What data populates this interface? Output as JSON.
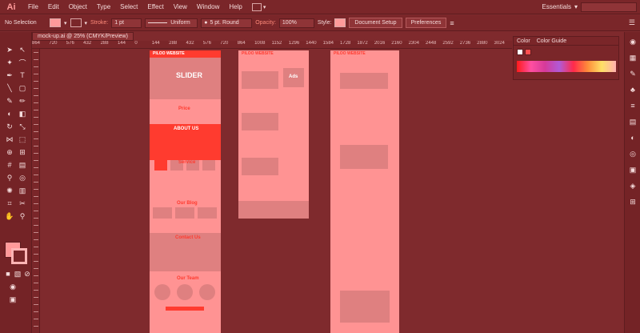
{
  "app": {
    "logo": "Ai"
  },
  "menu": [
    "File",
    "Edit",
    "Object",
    "Type",
    "Select",
    "Effect",
    "View",
    "Window",
    "Help"
  ],
  "workspace": "Essentials",
  "control": {
    "selection": "No Selection",
    "stroke_label": "Stroke:",
    "stroke_weight": "1 pt",
    "profile": "Uniform",
    "brush": "5 pt. Round",
    "opacity_label": "Opacity:",
    "opacity_value": "100%",
    "style_label": "Style:",
    "document_setup": "Document Setup",
    "preferences": "Preferences"
  },
  "document_tab": "mock-up.ai @ 25% (CMYK/Preview)",
  "ruler_marks": [
    "864",
    "720",
    "576",
    "432",
    "288",
    "144",
    "0",
    "144",
    "288",
    "432",
    "576",
    "720",
    "864",
    "1008",
    "1152",
    "1296",
    "1440",
    "1584",
    "1728",
    "1872",
    "2016",
    "2160",
    "2304",
    "2448",
    "2592",
    "2736",
    "2880",
    "3024"
  ],
  "color_panel": {
    "tab_color": "Color",
    "tab_guide": "Color Guide"
  },
  "artboard1": {
    "logo": "PILOO WEBSITE",
    "hero": "SLIDER",
    "price": "Price",
    "about": "ABOUT US",
    "service": "Service",
    "blog": "Our Blog",
    "contact": "Contact Us",
    "team": "Our Team"
  },
  "artboard2": {
    "logo": "PILOO WEBSITE",
    "ads": "Ads"
  },
  "artboard3": {
    "logo": "PILOO WEBSITE"
  },
  "colors": {
    "accent": "#ff3b2f",
    "artboard": "#ff9393",
    "chrome": "#7a2629"
  }
}
